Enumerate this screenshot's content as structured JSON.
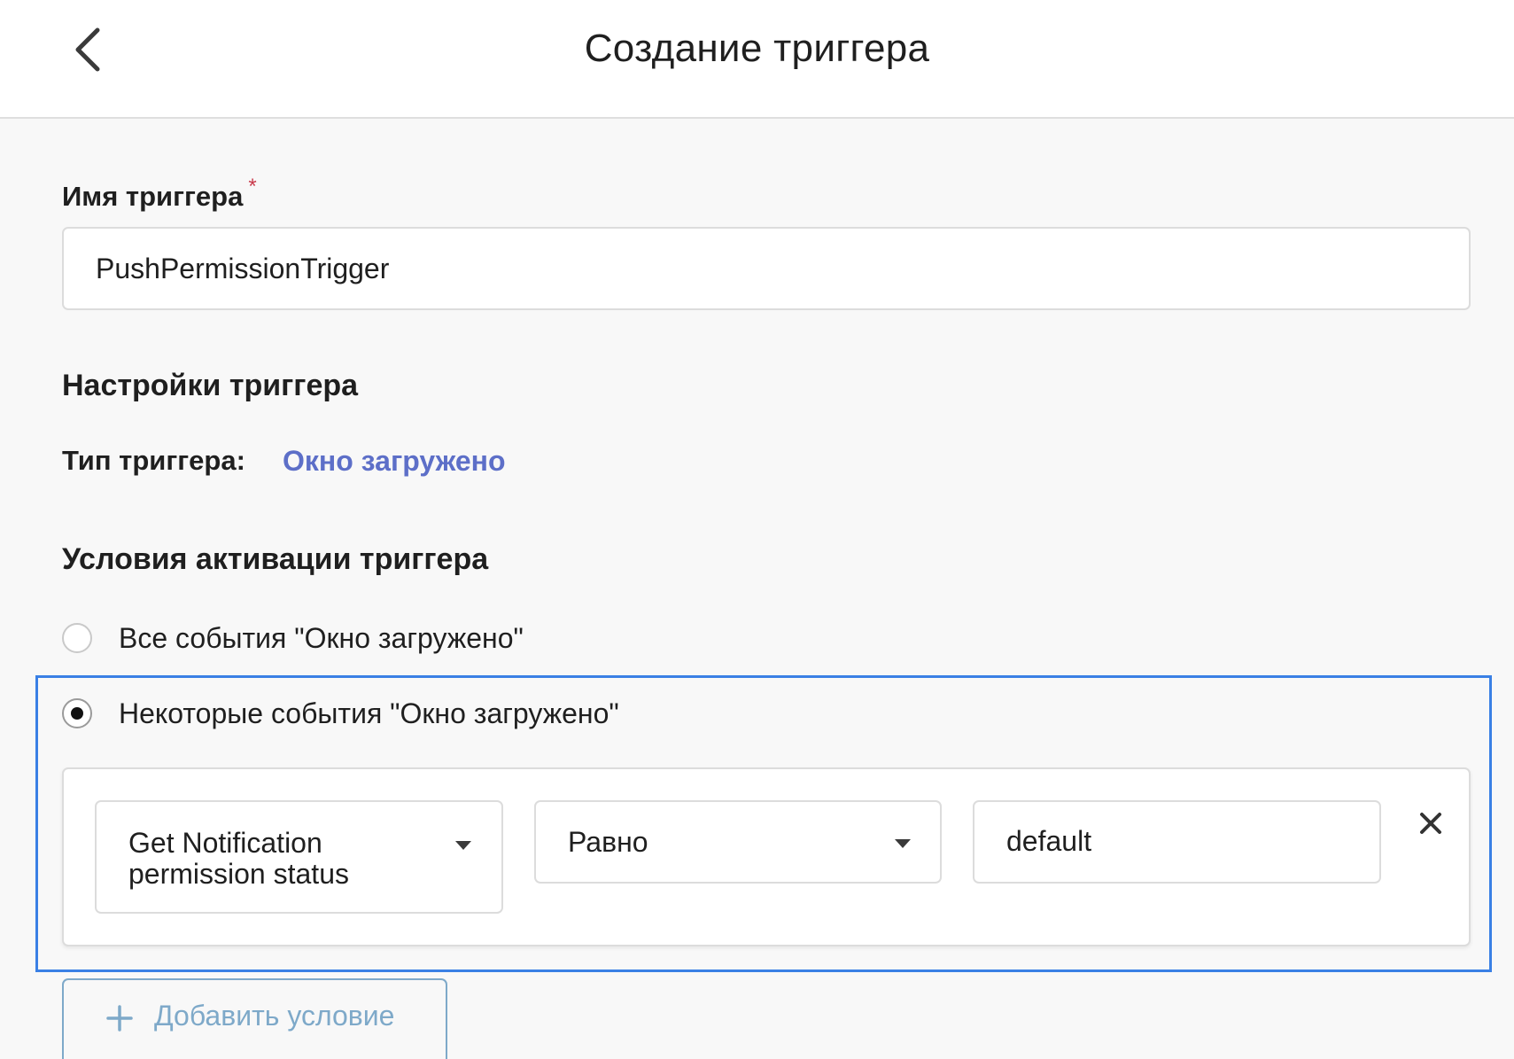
{
  "header": {
    "title": "Создание триггера",
    "back_icon": "chevron-left-icon"
  },
  "form": {
    "name_label": "Имя триггера",
    "required_mark": "*",
    "name_value": "PushPermissionTrigger"
  },
  "settings": {
    "heading": "Настройки триггера",
    "type_label": "Тип триггера:",
    "type_value": "Окно загружено"
  },
  "conditions": {
    "heading": "Условия активации триггера",
    "options": [
      {
        "label": "Все события \"Окно загружено\"",
        "selected": false
      },
      {
        "label": "Некоторые события \"Окно загружено\"",
        "selected": true
      }
    ],
    "rule": {
      "field_line1": "Get Notification",
      "field_line2": "permission status",
      "operator": "Равно",
      "value": "default",
      "remove_icon": "close-icon"
    },
    "add_label": "Добавить условие",
    "add_icon": "plus-icon"
  },
  "colors": {
    "accent_link": "#5d6fc8",
    "focus_border": "#3a80e5",
    "add_button": "#7ea9c9",
    "required": "#c93a4b"
  }
}
